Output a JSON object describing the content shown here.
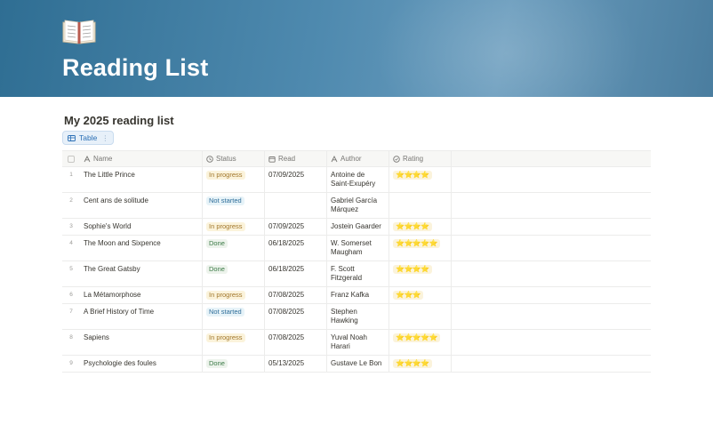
{
  "page": {
    "icon": "open-book-icon",
    "title": "Reading List"
  },
  "database": {
    "title": "My 2025 reading list",
    "view_tab": {
      "label": "Table",
      "icon": "table-icon"
    }
  },
  "table": {
    "columns": [
      {
        "key": "name",
        "label": "Name",
        "icon": "text-type-icon"
      },
      {
        "key": "status",
        "label": "Status",
        "icon": "status-icon"
      },
      {
        "key": "read",
        "label": "Read",
        "icon": "calendar-icon"
      },
      {
        "key": "author",
        "label": "Author",
        "icon": "text-type-icon"
      },
      {
        "key": "rating",
        "label": "Rating",
        "icon": "status-icon"
      }
    ],
    "rows": [
      {
        "num": "1",
        "name": "The Little Prince",
        "status": "In progress",
        "read": "07/09/2025",
        "author": "Antoine de Saint-Exupéry",
        "rating": 4
      },
      {
        "num": "2",
        "name": "Cent ans de solitude",
        "status": "Not started",
        "read": "",
        "author": "Gabriel García Márquez",
        "rating": 0
      },
      {
        "num": "3",
        "name": "Sophie's World",
        "status": "In progress",
        "read": "07/09/2025",
        "author": "Jostein Gaarder",
        "rating": 4
      },
      {
        "num": "4",
        "name": "The Moon and Sixpence",
        "status": "Done",
        "read": "06/18/2025",
        "author": "W. Somerset Maugham",
        "rating": 5
      },
      {
        "num": "5",
        "name": "The Great Gatsby",
        "status": "Done",
        "read": "06/18/2025",
        "author": "F. Scott Fitzgerald",
        "rating": 4
      },
      {
        "num": "6",
        "name": "La Métamorphose",
        "status": "In progress",
        "read": "07/08/2025",
        "author": "Franz Kafka",
        "rating": 3
      },
      {
        "num": "7",
        "name": "A Brief History of Time",
        "status": "Not started",
        "read": "07/08/2025",
        "author": "Stephen Hawking",
        "rating": 0
      },
      {
        "num": "8",
        "name": "Sapiens",
        "status": "In progress",
        "read": "07/08/2025",
        "author": "Yuval Noah Harari",
        "rating": 5
      },
      {
        "num": "9",
        "name": "Psychologie des foules",
        "status": "Done",
        "read": "05/13/2025",
        "author": "Gustave Le Bon",
        "rating": 4
      }
    ]
  },
  "colors": {
    "in_progress_bg": "#fbf3db",
    "not_started_bg": "#e7f3f8",
    "done_bg": "#edf3ec",
    "star": "#e6a817"
  }
}
